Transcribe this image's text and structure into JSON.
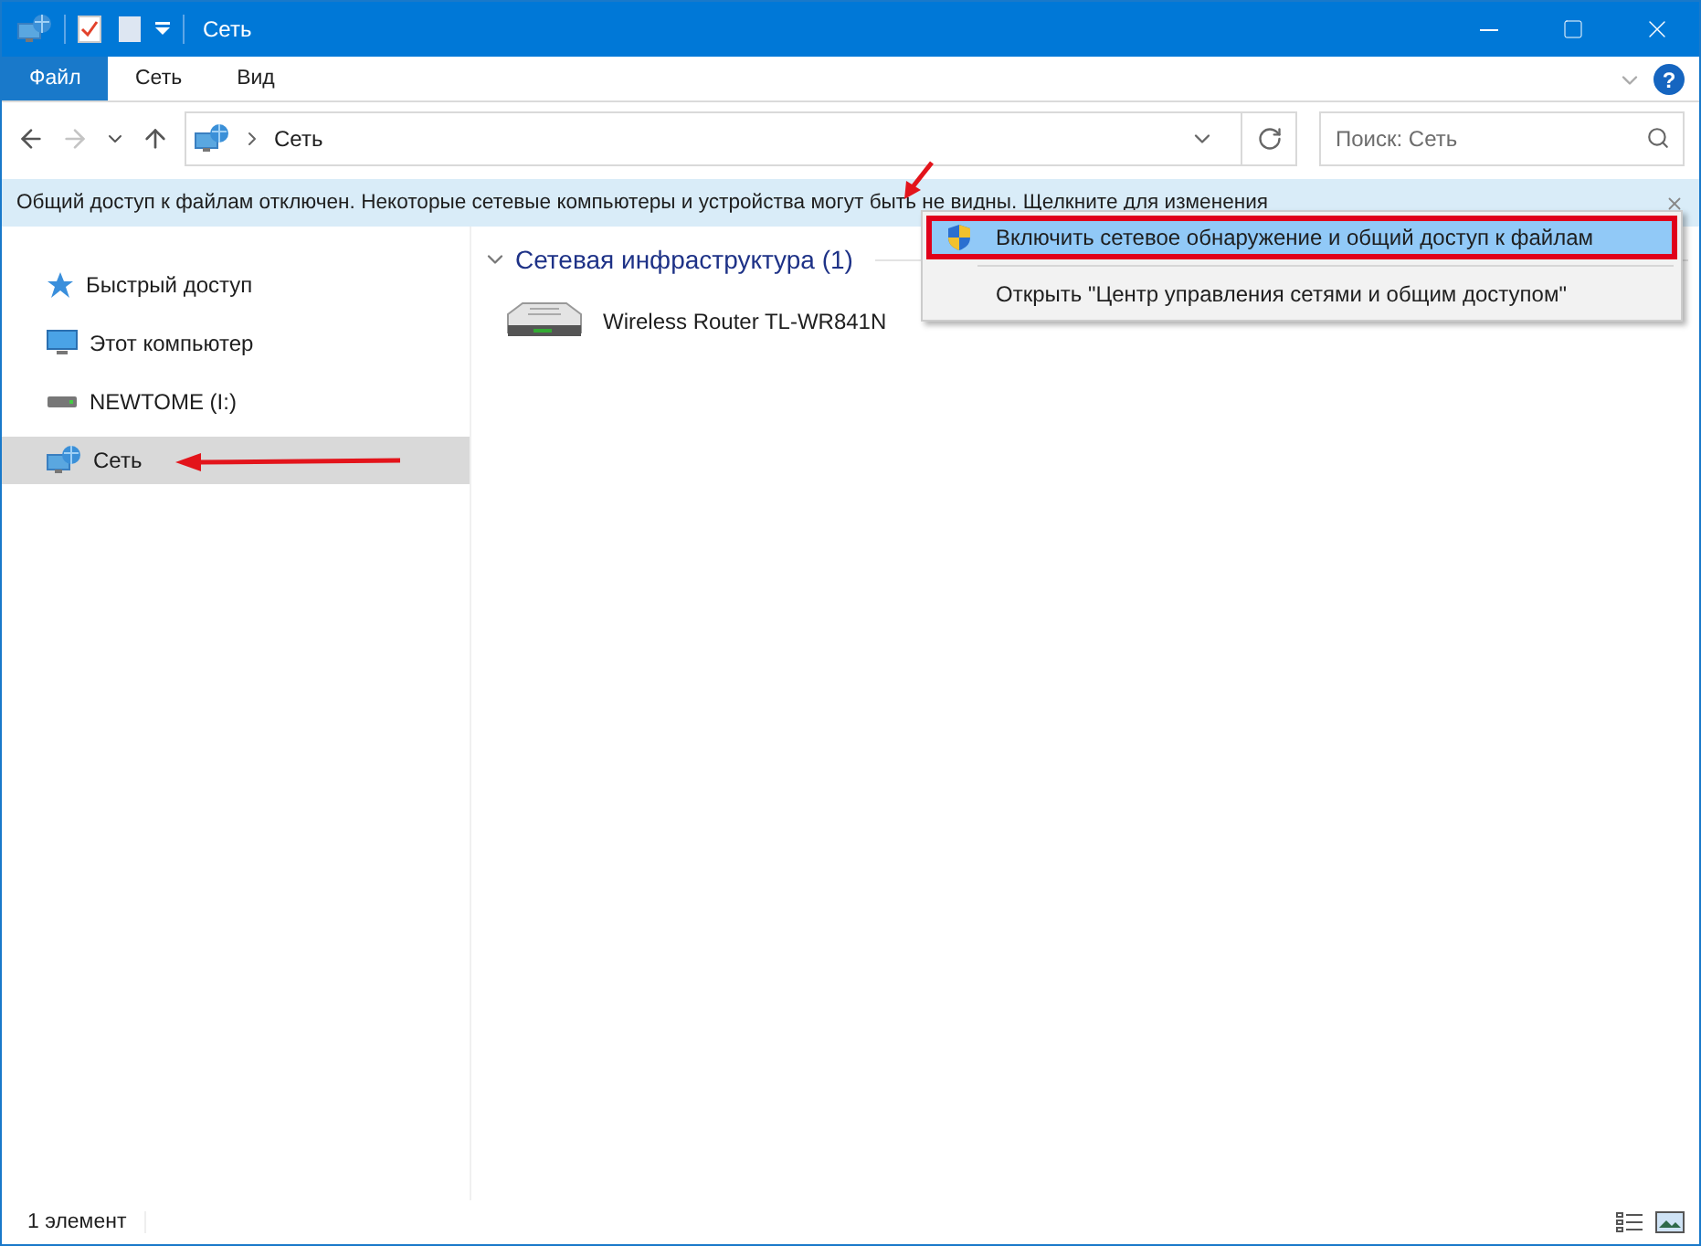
{
  "window": {
    "title": "Сеть"
  },
  "ribbon_tabs": [
    {
      "label": "Файл",
      "selected": true
    },
    {
      "label": "Сеть",
      "selected": false
    },
    {
      "label": "Вид",
      "selected": false
    }
  ],
  "help_button": {
    "label": "?"
  },
  "address": {
    "path": "Сеть"
  },
  "search": {
    "placeholder": "Поиск: Сеть"
  },
  "infobar": {
    "text": "Общий доступ к файлам отключен. Некоторые сетевые компьютеры и устройства могут быть не видны. Щелкните для изменения"
  },
  "context_menu": {
    "items": [
      {
        "label": "Включить сетевое обнаружение и общий доступ к файлам",
        "kind": "shield",
        "selected": true
      },
      {
        "label": "Открыть \"Центр управления сетями и общим доступом\"",
        "kind": "plain",
        "selected": false
      }
    ]
  },
  "sidebar": {
    "items": [
      {
        "label": "Быстрый доступ",
        "kind": "star",
        "selected": false
      },
      {
        "label": "Этот компьютер",
        "kind": "computer",
        "selected": false
      },
      {
        "label": "NEWTOME (I:)",
        "kind": "drive",
        "selected": false
      },
      {
        "label": "Сеть",
        "kind": "network",
        "selected": true
      }
    ]
  },
  "group": {
    "title": "Сетевая инфраструктура (1)",
    "expanded": true,
    "items": [
      {
        "label": "Wireless Router TL-WR841N"
      }
    ]
  },
  "status_bar": {
    "text": "1 элемент"
  }
}
